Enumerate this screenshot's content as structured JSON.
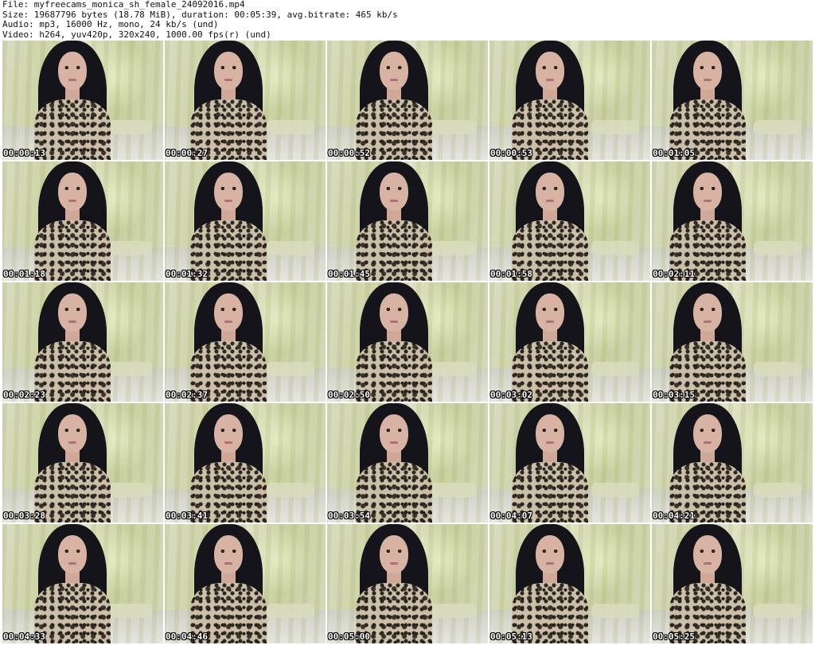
{
  "header": {
    "file_line": "File: myfreecams_monica_sh_female_24092016.mp4",
    "size_line": "Size: 19687796 bytes (18.78 MiB), duration: 00:05:39, avg.bitrate: 465 kb/s",
    "audio_line": "Audio: mp3, 16000 Hz, mono, 24 kb/s (und)",
    "video_line": "Video: h264, yuv420p, 320x240, 1000.00 fps(r) (und)"
  },
  "thumbnails": [
    {
      "timestamp": "00:00:13"
    },
    {
      "timestamp": "00:00:27"
    },
    {
      "timestamp": "00:00:52"
    },
    {
      "timestamp": "00:00:53"
    },
    {
      "timestamp": "00:01:05"
    },
    {
      "timestamp": "00:01:18"
    },
    {
      "timestamp": "00:01:32"
    },
    {
      "timestamp": "00:01:45"
    },
    {
      "timestamp": "00:01:58"
    },
    {
      "timestamp": "00:02:11"
    },
    {
      "timestamp": "00:02:23"
    },
    {
      "timestamp": "00:02:37"
    },
    {
      "timestamp": "00:02:50"
    },
    {
      "timestamp": "00:03:02"
    },
    {
      "timestamp": "00:03:15"
    },
    {
      "timestamp": "00:03:28"
    },
    {
      "timestamp": "00:03:41"
    },
    {
      "timestamp": "00:03:54"
    },
    {
      "timestamp": "00:04:07"
    },
    {
      "timestamp": "00:04:21"
    },
    {
      "timestamp": "00:04:33"
    },
    {
      "timestamp": "00:04:46"
    },
    {
      "timestamp": "00:05:00"
    },
    {
      "timestamp": "00:05:13"
    },
    {
      "timestamp": "00:05:25"
    }
  ]
}
